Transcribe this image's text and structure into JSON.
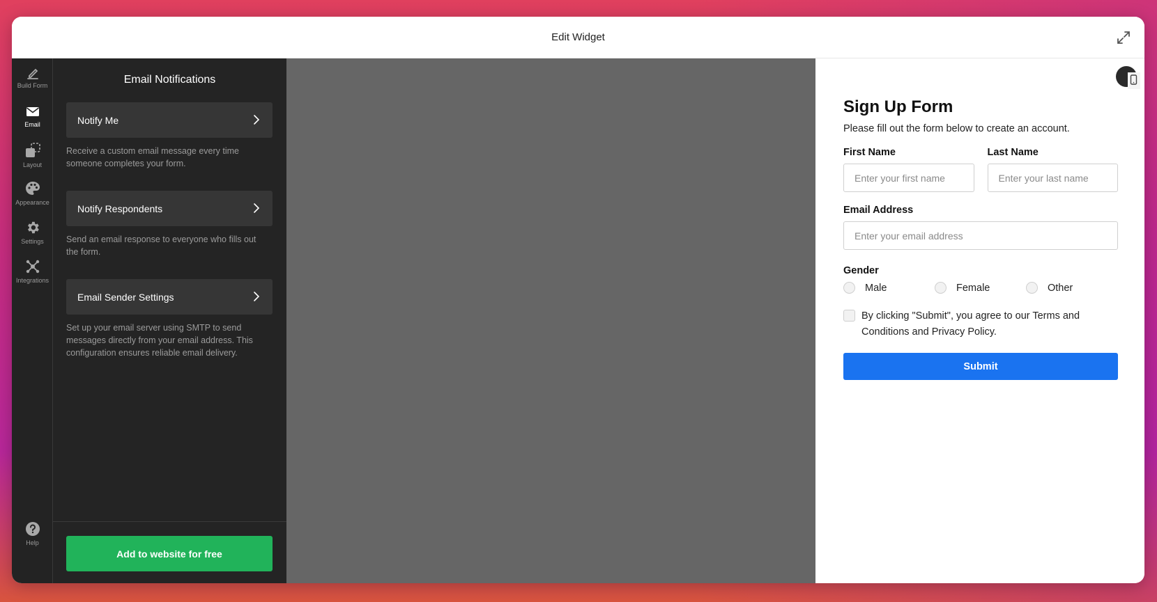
{
  "window": {
    "title": "Edit Widget"
  },
  "sidebar": {
    "items": [
      {
        "label": "Build Form",
        "icon": "pencil-icon"
      },
      {
        "label": "Email",
        "icon": "envelope-icon"
      },
      {
        "label": "Layout",
        "icon": "layout-icon"
      },
      {
        "label": "Appearance",
        "icon": "palette-icon"
      },
      {
        "label": "Settings",
        "icon": "gear-icon"
      },
      {
        "label": "Integrations",
        "icon": "integrations-icon"
      }
    ],
    "help": {
      "label": "Help",
      "icon": "help-icon"
    }
  },
  "panel": {
    "title": "Email Notifications",
    "cards": [
      {
        "label": "Notify Me",
        "description": "Receive a custom email message every time someone completes your form."
      },
      {
        "label": "Notify Respondents",
        "description": "Send an email response to everyone who fills out the form."
      },
      {
        "label": "Email Sender Settings",
        "description": "Set up your email server using SMTP to send messages directly from your email address. This configuration ensures reliable email delivery."
      }
    ],
    "add_button": "Add to website for free"
  },
  "form": {
    "title": "Sign Up Form",
    "subtitle": "Please fill out the form below to create an account.",
    "first_name": {
      "label": "First Name",
      "placeholder": "Enter your first name"
    },
    "last_name": {
      "label": "Last Name",
      "placeholder": "Enter your last name"
    },
    "email": {
      "label": "Email Address",
      "placeholder": "Enter your email address"
    },
    "gender": {
      "label": "Gender",
      "options": [
        "Male",
        "Female",
        "Other"
      ]
    },
    "agree_text": "By clicking \"Submit\", you agree to our Terms and Conditions and Privacy Policy.",
    "submit_label": "Submit"
  },
  "colors": {
    "accent": "#1a73f0",
    "cta": "#21b35a",
    "panel_bg": "#242424",
    "card_bg": "#363636",
    "canvas_bg": "#666666"
  }
}
